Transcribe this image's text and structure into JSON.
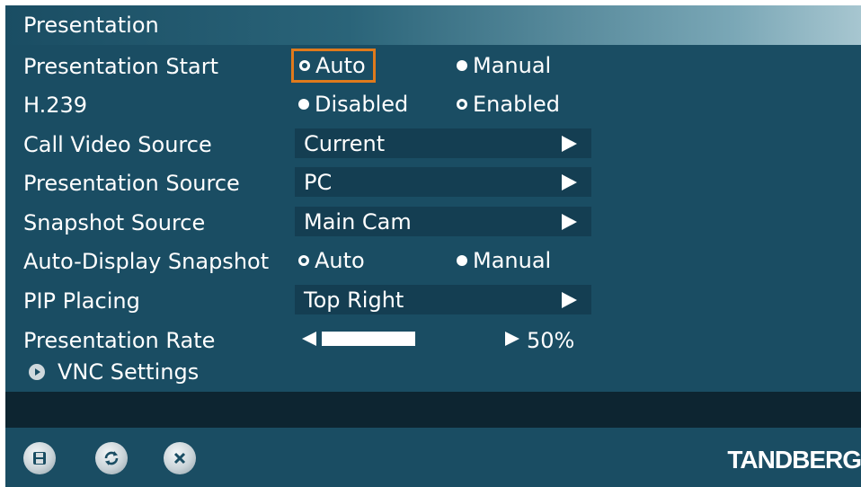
{
  "header": {
    "title": "Presentation"
  },
  "rows": {
    "presentation_start": {
      "label": "Presentation Start",
      "options": [
        "Auto",
        "Manual"
      ],
      "selected": "Auto"
    },
    "h239": {
      "label": "H.239",
      "options": [
        "Disabled",
        "Enabled"
      ],
      "selected": "Enabled"
    },
    "call_video_source": {
      "label": "Call Video Source",
      "value": "Current"
    },
    "presentation_source": {
      "label": "Presentation Source",
      "value": "PC"
    },
    "snapshot_source": {
      "label": "Snapshot Source",
      "value": "Main Cam"
    },
    "auto_display_snapshot": {
      "label": "Auto-Display Snapshot",
      "options": [
        "Auto",
        "Manual"
      ],
      "selected": "Auto"
    },
    "pip_placing": {
      "label": "PIP Placing",
      "value": "Top Right"
    },
    "presentation_rate": {
      "label": "Presentation Rate",
      "value_text": "50%",
      "value_fraction": 0.5
    }
  },
  "vnc": {
    "label": "VNC Settings"
  },
  "footer": {
    "buttons": [
      "save-icon",
      "refresh-icon",
      "close-icon"
    ],
    "brand": "TANDBERG"
  },
  "colors": {
    "background": "#1a4d63",
    "field": "#143e52",
    "focus": "#e07a1c",
    "status_bar": "#0d2531"
  }
}
